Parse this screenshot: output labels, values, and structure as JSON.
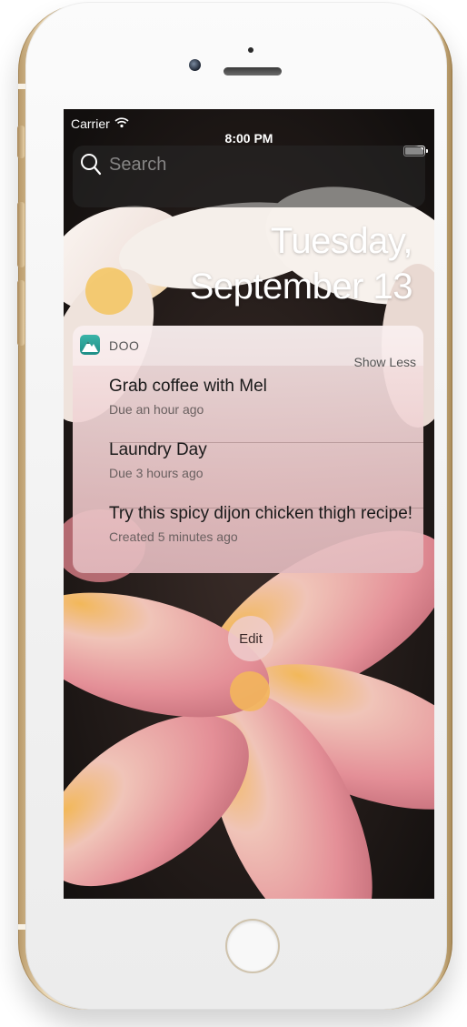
{
  "status_bar": {
    "carrier": "Carrier",
    "time": "8:00 PM",
    "wifi_icon": "wifi-icon",
    "battery_icon": "battery-icon"
  },
  "search": {
    "placeholder": "Search",
    "icon": "search-icon"
  },
  "date": {
    "line1": "Tuesday,",
    "line2": "September 13"
  },
  "notification": {
    "app_name": "DOO",
    "app_icon": "doo-app-icon",
    "show_less": "Show Less",
    "items": [
      {
        "title": "Grab coffee with Mel",
        "subtitle": "Due an hour ago"
      },
      {
        "title": "Laundry Day",
        "subtitle": "Due 3 hours ago"
      },
      {
        "title": "Try this spicy dijon chicken thigh recipe!",
        "subtitle": "Created 5 minutes ago"
      }
    ]
  },
  "edit_button": {
    "label": "Edit"
  },
  "colors": {
    "phone_gold": "#e9d6b3",
    "notification_bg": "#ecc9ca",
    "petal_pink": "#e8a2a6",
    "petal_center": "#f2b85a"
  }
}
